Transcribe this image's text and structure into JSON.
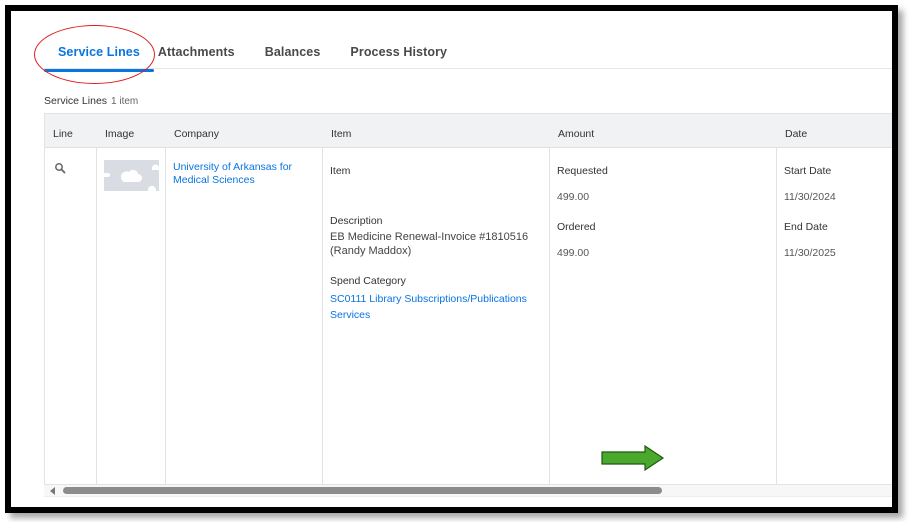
{
  "tabs": [
    {
      "label": "Service Lines",
      "active": true
    },
    {
      "label": "Attachments",
      "active": false
    },
    {
      "label": "Balances",
      "active": false
    },
    {
      "label": "Process History",
      "active": false
    }
  ],
  "section": {
    "title": "Service Lines",
    "count": "1 item"
  },
  "table": {
    "columns": [
      "Line",
      "Image",
      "Company",
      "Item",
      "Amount",
      "Date"
    ],
    "row": {
      "line_icon": "search-icon",
      "image_icon": "cloud-image-placeholder-icon",
      "company": "University of Arkansas for Medical Sciences",
      "item": {
        "item_label": "Item",
        "description_label": "Description",
        "description": "EB Medicine Renewal-Invoice #1810516 (Randy Maddox)",
        "spend_category_label": "Spend Category",
        "spend_category": "SC0111 Library Subscriptions/Publications Services"
      },
      "amount": {
        "requested_label": "Requested",
        "requested": "499.00",
        "ordered_label": "Ordered",
        "ordered": "499.00"
      },
      "date": {
        "start_label": "Start Date",
        "start": "11/30/2024",
        "end_label": "End Date",
        "end": "11/30/2025"
      }
    }
  },
  "annotations": {
    "ellipse_color": "#e01b1b",
    "arrow_color": "#4aa82c",
    "arrow_direction": "right"
  },
  "colors": {
    "accent": "#0875e1",
    "header_bg": "#f1f2f3"
  }
}
